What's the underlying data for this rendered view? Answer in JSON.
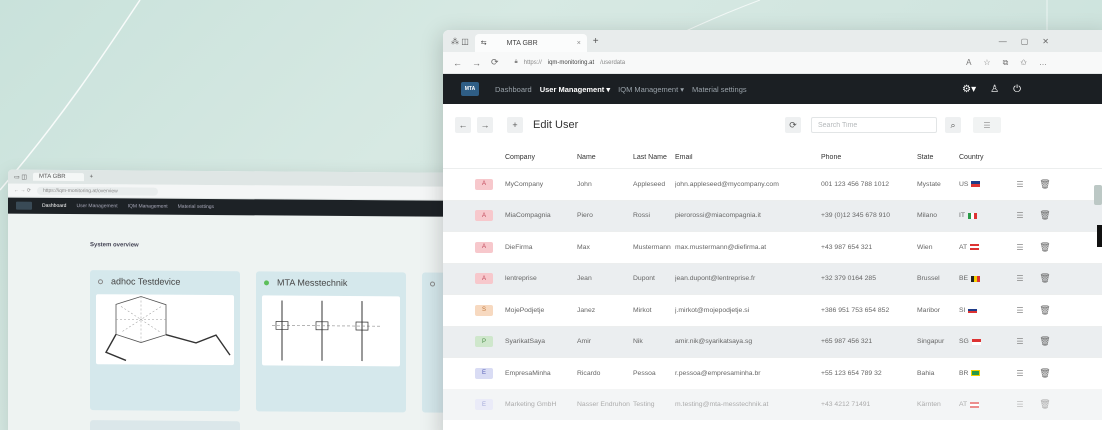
{
  "back_window": {
    "tab_label": "MTA GBR",
    "url": "https://iqm-monitoring.at/overview",
    "nav": [
      "Dashboard",
      "User Management",
      "IQM Management",
      "Material settings"
    ],
    "page_title": "System overview",
    "cards": [
      {
        "title": "adhoc Testdevice",
        "status": "grey"
      },
      {
        "title": "MTA Messtechnik",
        "status": "green"
      },
      {
        "title": "",
        "status": "grey"
      }
    ]
  },
  "front_window": {
    "tab_label": "MTA GBR",
    "url_prefix": "https://",
    "url_host": "iqm-monitoring.at",
    "url_path": "/userdata",
    "nav": {
      "logo": "MTA",
      "items": [
        "Dashboard",
        "User Management ▾",
        "IQM Management ▾",
        "Material settings"
      ],
      "active_index": 1
    },
    "toolbar": {
      "title": "Edit User",
      "search_placeholder": "Search Time"
    },
    "columns": [
      "Company",
      "Name",
      "Last Name",
      "Email",
      "Phone",
      "State",
      "Country"
    ],
    "rows": [
      {
        "badge": "A",
        "company": "MyCompany",
        "name": "John",
        "last": "Appleseed",
        "email": "john.appleseed@mycompany.com",
        "phone": "001 123 456 788 1012",
        "state": "Mystate",
        "country": "US"
      },
      {
        "badge": "A",
        "company": "MiaCompagnia",
        "name": "Piero",
        "last": "Rossi",
        "email": "pierorossi@miacompagnia.it",
        "phone": "+39 (0)12 345 678 910",
        "state": "Milano",
        "country": "IT"
      },
      {
        "badge": "A",
        "company": "DieFirma",
        "name": "Max",
        "last": "Mustermann",
        "email": "max.mustermann@diefirma.at",
        "phone": "+43 987 654 321",
        "state": "Wien",
        "country": "AT"
      },
      {
        "badge": "A",
        "company": "lentreprise",
        "name": "Jean",
        "last": "Dupont",
        "email": "jean.dupont@lentreprise.fr",
        "phone": "+32 379 0164 285",
        "state": "Brussel",
        "country": "BE"
      },
      {
        "badge": "S",
        "company": "MojePodjetje",
        "name": "Janez",
        "last": "Mirkot",
        "email": "j.mirkot@mojepodjetje.si",
        "phone": "+386 951 753 654 852",
        "state": "Maribor",
        "country": "SI"
      },
      {
        "badge": "P",
        "company": "SyarikatSaya",
        "name": "Amir",
        "last": "Nik",
        "email": "amir.nik@syarikatsaya.sg",
        "phone": "+65 987 456 321",
        "state": "Singapur",
        "country": "SG"
      },
      {
        "badge": "E",
        "company": "EmpresaMinha",
        "name": "Ricardo",
        "last": "Pessoa",
        "email": "r.pessoa@empresaminha.br",
        "phone": "+55 123 654 789 32",
        "state": "Bahia",
        "country": "BR"
      },
      {
        "badge": "E",
        "company": "Marketing GmbH",
        "name": "Nasser Endruhon",
        "last": "Testing",
        "email": "m.testing@mta-messtechnik.at",
        "phone": "+43 4212 71491",
        "state": "Kärnten",
        "country": "AT"
      }
    ]
  },
  "colors": {
    "badge_A": "#f7c8cc",
    "badge_S": "#f7d9c0",
    "badge_P": "#cfe7cc",
    "badge_E": "#d9dcf4",
    "nav_bg": "#1b1f23",
    "bg_mint": "#cfe4de"
  }
}
